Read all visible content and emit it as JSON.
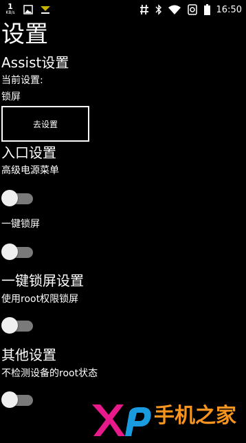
{
  "status_bar": {
    "net_speed_value": "1",
    "net_speed_unit": "KB/s",
    "time": "16:50",
    "icons": [
      "image-icon",
      "download-icon",
      "hash-icon",
      "bluetooth-icon",
      "wifi-icon",
      "vibrate-icon",
      "battery-icon"
    ]
  },
  "page": {
    "title": "设置"
  },
  "assist": {
    "header": "Assist设置",
    "current_label": "当前设置:",
    "current_value": "锁屏",
    "goto_button": "去设置"
  },
  "entry": {
    "header": "入口设置",
    "advanced_power_menu_label": "高级电源菜单",
    "advanced_power_menu_on": false,
    "one_key_lock_label": "一键锁屏",
    "one_key_lock_on": false
  },
  "one_key_lock_settings": {
    "header": "一键锁屏设置",
    "use_root_label": "使用root权限锁屏",
    "use_root_on": false
  },
  "other": {
    "header": "其他设置",
    "no_root_check_label": "不检测设备的root状态",
    "no_root_check_on": false
  },
  "watermark": {
    "logo_text": "手机之家",
    "colors": {
      "x": "#e8198b",
      "p": "#1a9be0",
      "text": "#f7941d"
    }
  }
}
